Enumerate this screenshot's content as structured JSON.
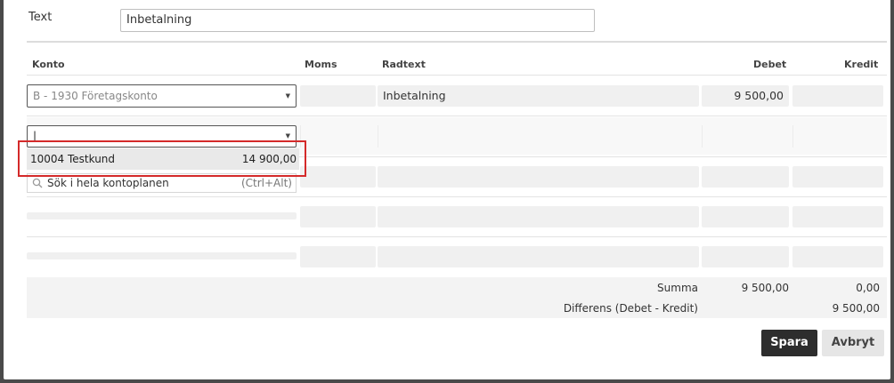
{
  "form": {
    "text_label": "Text",
    "text_value": "Inbetalning"
  },
  "table": {
    "headers": {
      "konto": "Konto",
      "moms": "Moms",
      "radtext": "Radtext",
      "debet": "Debet",
      "kredit": "Kredit"
    },
    "row1": {
      "account": "B - 1930 Företagskonto",
      "radtext": "Inbetalning",
      "debet": "9 500,00"
    },
    "row2": {
      "account_input": "|"
    }
  },
  "dropdown": {
    "option_name": "10004 Testkund",
    "option_amount": "14 900,00",
    "search_label": "Sök i hela kontoplanen",
    "search_shortcut": "(Ctrl+Alt)"
  },
  "totals": {
    "summa_label": "Summa",
    "summa_debet": "9 500,00",
    "summa_kredit": "0,00",
    "diff_label": "Differens (Debet - Kredit)",
    "diff_value": "9 500,00"
  },
  "buttons": {
    "save": "Spara",
    "cancel": "Avbryt"
  },
  "colors": {
    "highlight": "#d42a2a",
    "primary_button": "#2d2d2d"
  }
}
